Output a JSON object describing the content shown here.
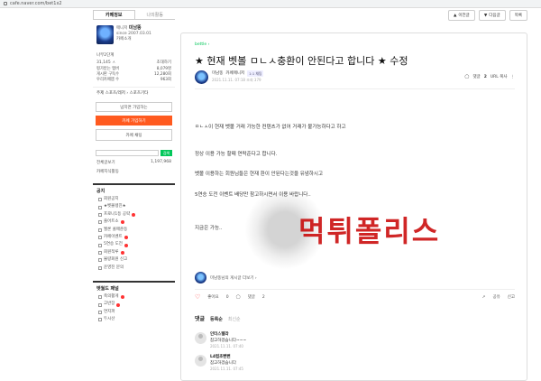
{
  "browser": {
    "url": "cafe.naver.com/bet1x2"
  },
  "sidebar": {
    "tabs": [
      {
        "label": "카페정보"
      },
      {
        "label": "나의활동"
      }
    ],
    "cafe": {
      "manager_label": "매니저",
      "manager_name": "미남뚱",
      "since": "since 2007.03.01",
      "intro": "카페소개"
    },
    "level": {
      "label": "나무2단계",
      "members": "31,145 ㅅ",
      "invite": "초대하기"
    },
    "stats": [
      {
        "label": "평가받는 멤버",
        "value": "8,079명"
      },
      {
        "label": "게시판 구독수",
        "value": "12,280회"
      },
      {
        "label": "우리카페앱 수",
        "value": "963회"
      }
    ],
    "topic": "주제 스포츠/레저 › 스포츠기타",
    "buttons": {
      "star": "넘치면 가입하는",
      "join": "카페 가입하기",
      "chat": "카페 채팅"
    },
    "search_btn": "검색",
    "all_posts": {
      "label": "전체글보기",
      "count": "1,197,968"
    },
    "cafe_tag": "카페지식활동",
    "notice_title": "공지",
    "boards": [
      {
        "label": "회원공지",
        "new": false
      },
      {
        "label": "★벳몰렝친★",
        "new": false
      },
      {
        "label": "프로나1등 공략",
        "new": true
      },
      {
        "label": "줄어트소",
        "new": true
      },
      {
        "label": "월론 콜매준등",
        "new": false
      },
      {
        "label": "카페이벤트",
        "new": true
      },
      {
        "label": "5연승 도전",
        "new": true
      },
      {
        "label": "회원적루",
        "new": true
      },
      {
        "label": "불량회원 신고",
        "new": false
      },
      {
        "label": "운영진 문의",
        "new": false
      }
    ],
    "section2_title": "벳월드 패널",
    "boards2": [
      {
        "label": "축의활게",
        "new": true
      },
      {
        "label": "고반장",
        "new": true
      },
      {
        "label": "연지파",
        "new": false
      },
      {
        "label": "두시산",
        "new": false
      }
    ]
  },
  "nav": {
    "prev": "이전글",
    "next": "다음글",
    "list": "목록"
  },
  "article": {
    "breadcrumb": "bettle ›",
    "title": "★ 현재 벳볼 ㅁㄴㅅ충환이 안된다고 합니다 ★ 수정",
    "author": {
      "name": "미남뚱",
      "role": "카페매니저",
      "grade": "1:1 채팅",
      "date": "2021.11.11. 07:18",
      "views": "조회 379"
    },
    "comment_label": "댓글",
    "comment_count": "2",
    "url_copy": "URL 복사",
    "body": [
      "ㅁㄴㅅ이 현재 벳볼 거래 가능한 컨텐츠가 없어 거래가 불가능하다고 하고",
      "정상 이용 가능 할때 연락준다고 합니다.",
      "벳볼 이용하는 회원님들은 현재 환이 안된다는것을 유념하시고",
      "5연승 도전 이벤트 배당만 참고하시면서 이용 바랍니다..",
      "지금은 가능.."
    ],
    "watermark": "먹튀폴리스",
    "more_by": "미남뚱님의 게시글 더보기 ›",
    "like": "좋아요",
    "like_count": "0",
    "comment_action": "댓글",
    "comment_action_count": "2",
    "share": "공유",
    "report": "신고"
  },
  "comments": {
    "label": "댓글",
    "sort_on": "등록순",
    "sort_off": "최신순",
    "items": [
      {
        "nick": "인터스텔라",
        "text": "참고하겠습니다~~~",
        "date": "2021.11.11. 07:40"
      },
      {
        "nick": "L4럽초뻔뻔",
        "text": "참고하겠습니다",
        "date": "2021.11.11. 07:45"
      }
    ]
  }
}
